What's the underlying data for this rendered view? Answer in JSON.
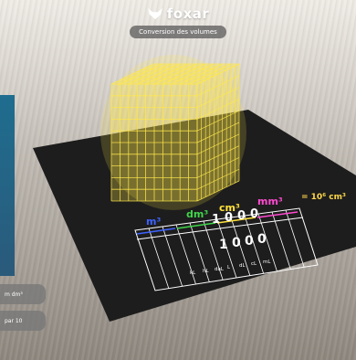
{
  "header": {
    "brand_name": "foxar",
    "subtitle": "Conversion des volumes"
  },
  "side_buttons": [
    {
      "label": "m dm³"
    },
    {
      "label": "par 10"
    }
  ],
  "table": {
    "units": [
      {
        "label": "m³",
        "color": "#3d63ff"
      },
      {
        "label": "dm³",
        "color": "#41d44b"
      },
      {
        "label": "cm³",
        "color": "#ffe23a"
      },
      {
        "label": "mm³",
        "color": "#ff4ad0"
      }
    ],
    "row1_digits": [
      "1",
      "0",
      "0",
      "0"
    ],
    "row2_digits": [
      "1",
      "0",
      "0",
      "0"
    ],
    "liquid_units": [
      "kL",
      "hL",
      "daL",
      "L",
      "dL",
      "cL",
      "mL"
    ],
    "equation": "= 10⁶ cm³",
    "colors": {
      "line": "#ffffff",
      "digit": "#ffffff",
      "equation": "#ffd84a"
    }
  },
  "cube": {
    "color": "#ffe84a"
  }
}
